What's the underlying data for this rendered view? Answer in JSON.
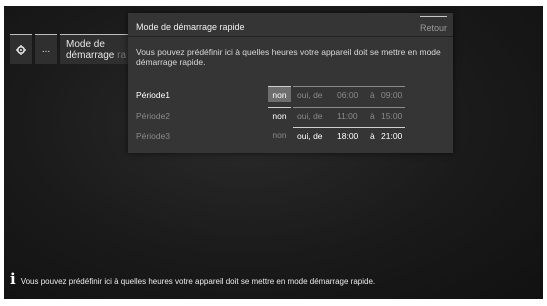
{
  "breadcrumb": {
    "gear_icon": "gear-icon",
    "dots": "...",
    "mode_line1": "Mode de",
    "mode_line2": "démarrage",
    "mode_ghost": "ra"
  },
  "dialog": {
    "title": "Mode de démarrage rapide",
    "back": "Retour",
    "description": "Vous pouvez prédéfinir ici à quelles heures votre appareil doit se mettre en mode démarrage rapide.",
    "periods": [
      {
        "label": "Période1",
        "non": "non",
        "oui": "oui, de",
        "start": "06:00",
        "a": "à",
        "end": "09:00",
        "selected": "non"
      },
      {
        "label": "Période2",
        "non": "non",
        "oui": "oui, de",
        "start": "11:00",
        "a": "à",
        "end": "15:00",
        "selected": "non"
      },
      {
        "label": "Période3",
        "non": "non",
        "oui": "oui, de",
        "start": "18:00",
        "a": "à",
        "end": "21:00",
        "selected": "oui"
      }
    ]
  },
  "info_bar": {
    "icon": "info-icon",
    "text": "Vous pouvez prédéfinir ici à quelles heures votre appareil doit se mettre en mode démarrage rapide."
  }
}
